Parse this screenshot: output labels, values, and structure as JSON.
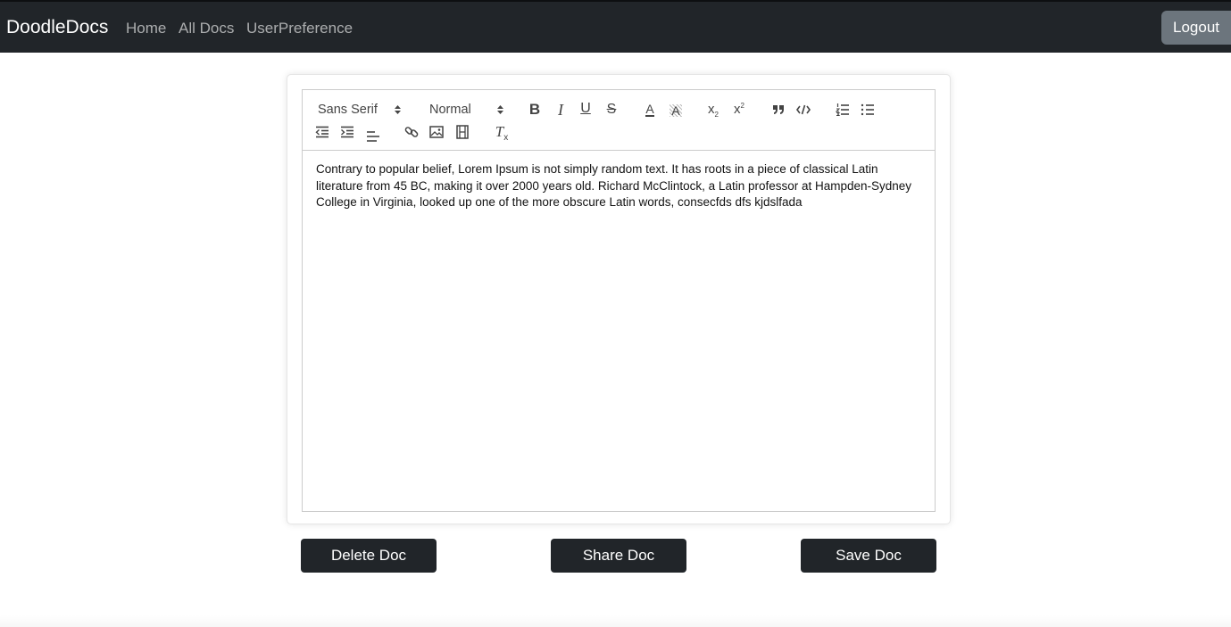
{
  "navbar": {
    "brand": "DoodleDocs",
    "links": [
      {
        "label": "Home"
      },
      {
        "label": "All Docs"
      },
      {
        "label": "UserPreference"
      }
    ],
    "logout_label": "Logout"
  },
  "toolbar": {
    "font_picker": "Sans Serif",
    "size_picker": "Normal",
    "icons": [
      "bold-icon",
      "italic-icon",
      "underline-icon",
      "strikethrough-icon",
      "font-color-icon",
      "background-color-icon",
      "subscript-icon",
      "superscript-icon",
      "blockquote-icon",
      "code-icon",
      "ordered-list-icon",
      "bullet-list-icon",
      "outdent-icon",
      "indent-icon",
      "align-icon",
      "link-icon",
      "image-icon",
      "video-icon",
      "clear-format-icon"
    ],
    "labels": {
      "bold": "B",
      "italic": "I",
      "underline": "U",
      "strike": "S",
      "color": "A",
      "background": "A",
      "subscript": "x",
      "subscript_mark": "2",
      "superscript": "x",
      "superscript_mark": "2",
      "clean": "T",
      "clean_mark": "x"
    }
  },
  "editor": {
    "content": "Contrary to popular belief, Lorem Ipsum is not simply random text. It has roots in a piece of classical Latin literature from 45 BC, making it over 2000 years old. Richard McClintock, a Latin professor at Hampden-Sydney College in Virginia, looked up one of the more obscure Latin words, consecfds dfs kjdslfada"
  },
  "actions": {
    "delete_label": "Delete Doc",
    "share_label": "Share Doc",
    "save_label": "Save Doc"
  },
  "colors": {
    "navbar_bg": "#212529",
    "button_dark": "#212529",
    "button_secondary": "#6c757d",
    "icon": "#444444"
  }
}
